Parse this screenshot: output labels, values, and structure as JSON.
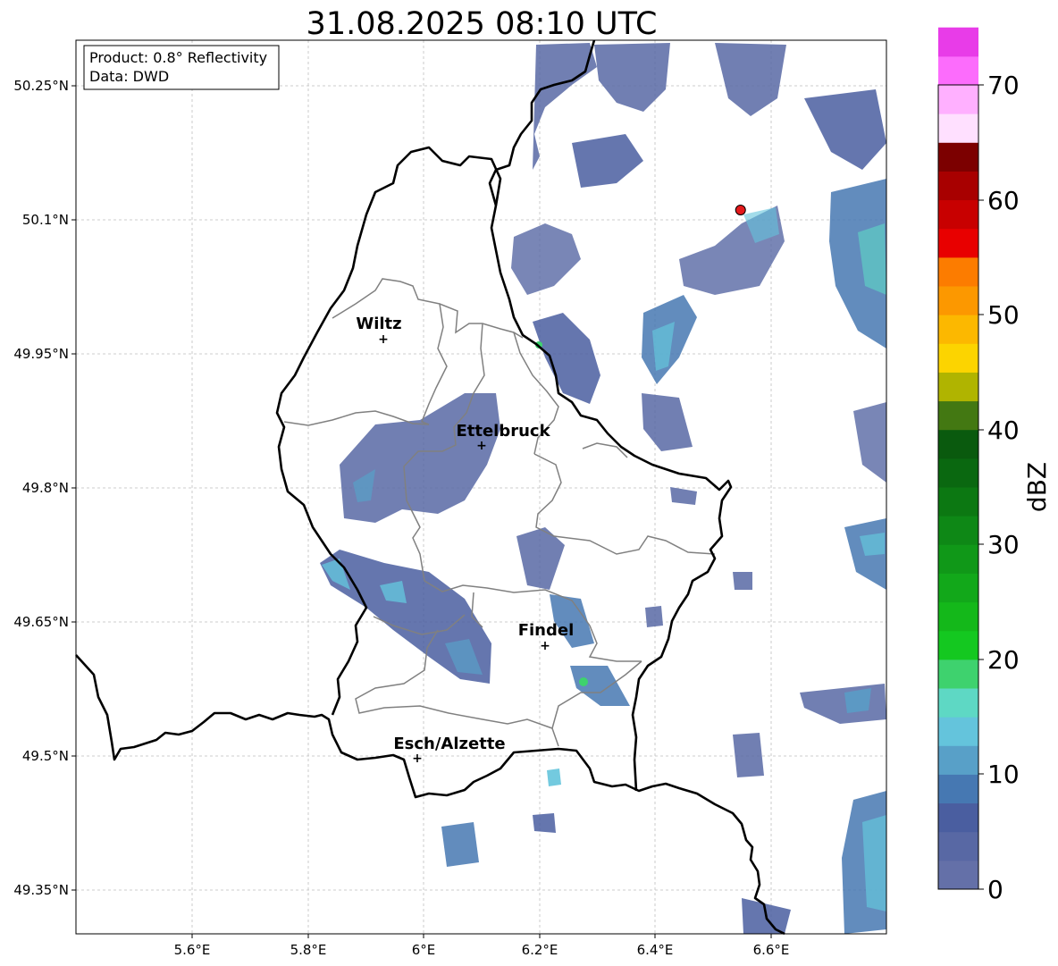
{
  "title": "31.08.2025 08:10 UTC",
  "info_box": {
    "product": "Product: 0.8° Reflectivity",
    "data": "Data: DWD"
  },
  "axes": {
    "x_ticks": [
      "5.6°E",
      "5.8°E",
      "6°E",
      "6.2°E",
      "6.4°E",
      "6.6°E"
    ],
    "y_ticks": [
      "50.25°N",
      "50.1°N",
      "49.95°N",
      "49.8°N",
      "49.65°N",
      "49.5°N",
      "49.35°N"
    ],
    "lon_range": [
      5.4,
      6.8
    ],
    "lat_range": [
      49.3,
      50.3
    ]
  },
  "cities": [
    {
      "name": "Wiltz",
      "lon": 5.93,
      "lat": 49.968
    },
    {
      "name": "Ettelbruck",
      "lon": 6.1,
      "lat": 49.848
    },
    {
      "name": "Findel",
      "lon": 6.21,
      "lat": 49.627
    },
    {
      "name": "Esch/Alzette",
      "lon": 5.99,
      "lat": 49.5
    }
  ],
  "radar_site": {
    "lon": 6.548,
    "lat": 50.11,
    "color": "#e41a1c"
  },
  "colorbar": {
    "label": "dBZ",
    "ticks": [
      "0",
      "10",
      "20",
      "30",
      "40",
      "50",
      "60",
      "70"
    ],
    "min": 0,
    "max": 70,
    "step": 2.5,
    "colors": [
      "#6470a8",
      "#5868a4",
      "#4a5ea0",
      "#4678b2",
      "#58a0c8",
      "#64c4dc",
      "#5ed8c4",
      "#3ed26e",
      "#14c820",
      "#14b81a",
      "#12a81a",
      "#109818",
      "#0e8816",
      "#0c7812",
      "#0a6810",
      "#0a5a0e",
      "#437812",
      "#b0b400",
      "#fcd400",
      "#fcb800",
      "#fc9800",
      "#fc7c00",
      "#e80000",
      "#c80000",
      "#a80000",
      "#7c0000",
      "#ffe0ff",
      "#ffb0ff",
      "#fc6cfc",
      "#e83ce8"
    ]
  }
}
